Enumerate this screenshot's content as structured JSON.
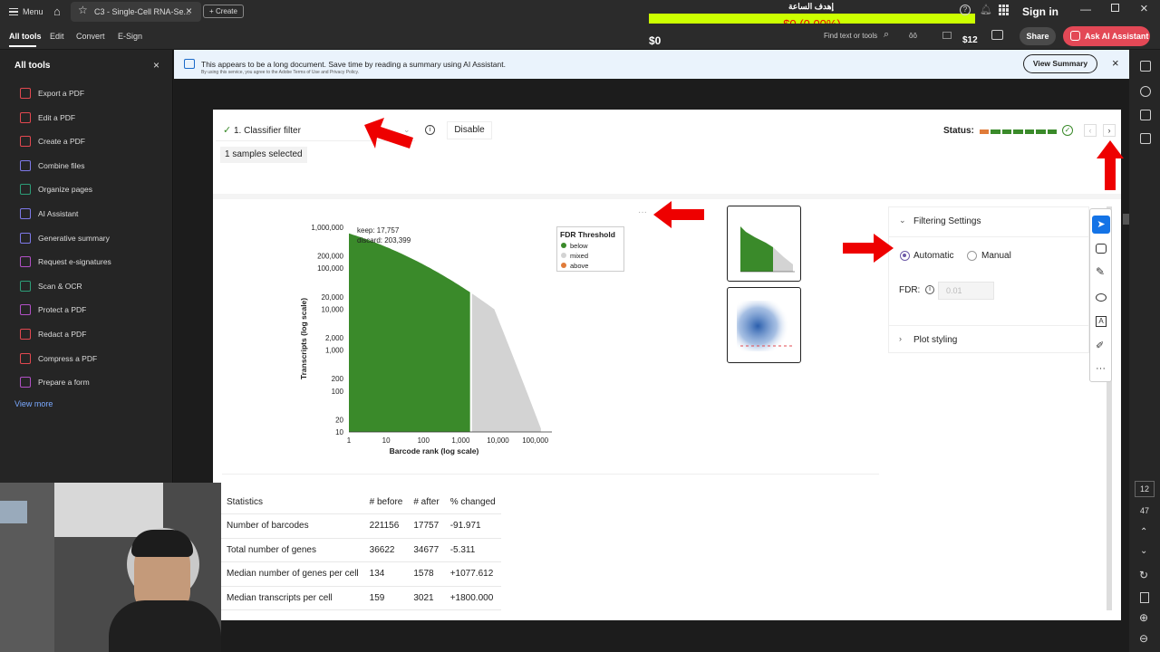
{
  "titlebar": {
    "menu_label": "Menu",
    "tab_title": "C3 - Single-Cell RNA-Se...",
    "create_label": "Create",
    "arabic_text": "إهدف الساعة",
    "money_display": "$0 (0.00%)",
    "money_left": "$0",
    "money_right": "$12",
    "sign_in": "Sign in"
  },
  "menubar": {
    "items": [
      "All tools",
      "Edit",
      "Convert",
      "E-Sign"
    ],
    "find_placeholder": "Find text or tools",
    "share_label": "Share",
    "ai_assistant_label": "Ask AI Assistant"
  },
  "sidebar": {
    "title": "All tools",
    "items": [
      {
        "label": "Export a PDF",
        "color": "#e34850"
      },
      {
        "label": "Edit a PDF",
        "color": "#e34850"
      },
      {
        "label": "Create a PDF",
        "color": "#e34850"
      },
      {
        "label": "Combine files",
        "color": "#7e79e8"
      },
      {
        "label": "Organize pages",
        "color": "#2d9d78"
      },
      {
        "label": "AI Assistant",
        "color": "#7e79e8"
      },
      {
        "label": "Generative summary",
        "color": "#7e79e8"
      },
      {
        "label": "Request e-signatures",
        "color": "#b150c5"
      },
      {
        "label": "Scan & OCR",
        "color": "#2d9d78"
      },
      {
        "label": "Protect a PDF",
        "color": "#b150c5"
      },
      {
        "label": "Redact a PDF",
        "color": "#e34850"
      },
      {
        "label": "Compress a PDF",
        "color": "#e34850"
      },
      {
        "label": "Prepare a form",
        "color": "#b150c5"
      }
    ],
    "view_more": "View more"
  },
  "banner": {
    "text": "This appears to be a long document. Save time by reading a summary using AI Assistant.",
    "subtext": "By using this service, you agree to the Adobe Terms of Use and Privacy Policy.",
    "button": "View Summary"
  },
  "panel": {
    "filter_label": "1. Classifier filter",
    "disable_label": "Disable",
    "samples_selected": "1 samples selected",
    "status_label": "Status:",
    "filtering_settings": "Filtering Settings",
    "automatic": "Automatic",
    "manual": "Manual",
    "fdr_label": "FDR:",
    "fdr_placeholder": "0.01",
    "plot_styling": "Plot styling"
  },
  "chart_data": {
    "type": "area",
    "xlabel": "Barcode rank (log scale)",
    "ylabel": "Transcripts (log scale)",
    "x_ticks": [
      "1",
      "10",
      "100",
      "1,000",
      "10,000",
      "100,000"
    ],
    "y_ticks": [
      "1,000,000",
      "200,000",
      "100,000",
      "20,000",
      "10,000",
      "2,000",
      "1,000",
      "200",
      "100",
      "20",
      "10"
    ],
    "annotations": [
      "keep: 17,757",
      "discard: 203,399"
    ],
    "legend_title": "FDR Threshold",
    "series": [
      {
        "name": "below",
        "color": "#3a8a2a"
      },
      {
        "name": "mixed",
        "color": "#d3d3d3"
      },
      {
        "name": "above",
        "color": "#e07b39"
      }
    ],
    "legend_position": "top-right"
  },
  "stats": {
    "headers": [
      "Statistics",
      "# before",
      "# after",
      "% changed"
    ],
    "rows": [
      [
        "Number of barcodes",
        "221156",
        "17757",
        "-91.971"
      ],
      [
        "Total number of genes",
        "36622",
        "34677",
        "-5.311"
      ],
      [
        "Median number of genes per cell",
        "134",
        "1578",
        "+1077.612"
      ],
      [
        "Median transcripts per cell",
        "159",
        "3021",
        "+1800.000"
      ]
    ]
  },
  "rightrail": {
    "page_num": "12",
    "page_total": "47"
  }
}
